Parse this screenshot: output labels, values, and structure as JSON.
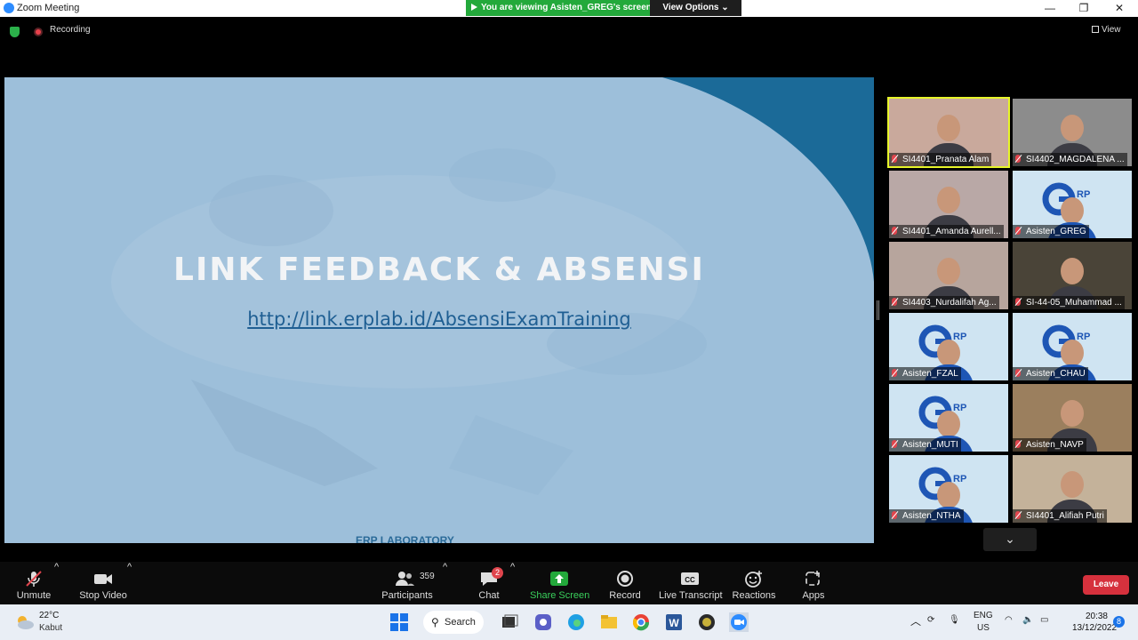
{
  "window": {
    "title": "Zoom Meeting",
    "minimize": "—",
    "maximize": "❐",
    "close": "✕"
  },
  "banner": {
    "viewing_text": "You are viewing Asisten_GREG's screen",
    "view_options": "View Options ⌄"
  },
  "status": {
    "recording": "Recording",
    "view": "View"
  },
  "slide": {
    "title": "LINK FEEDBACK & ABSENSI",
    "link": "http://link.erplab.id/AbsensiExamTraining",
    "footer": "ERP LABORATORY"
  },
  "participants_tiles": [
    {
      "name": "SI4401_Pranata Alam",
      "active": true,
      "bg": "#c9a99c"
    },
    {
      "name": "SI4402_MAGDALENA ...",
      "bg": "#8c8c8c"
    },
    {
      "name": "SI4401_Amanda Aurell...",
      "bg": "#b9a8a6"
    },
    {
      "name": "Asisten_GREG",
      "bg": "#cfe4f2"
    },
    {
      "name": "SI4403_Nurdalifah Ag...",
      "bg": "#b7a59d"
    },
    {
      "name": "SI-44-05_Muhammad ...",
      "bg": "#4a4438"
    },
    {
      "name": "Asisten_FZAL",
      "bg": "#cfe4f2"
    },
    {
      "name": "Asisten_CHAU",
      "bg": "#cfe4f2"
    },
    {
      "name": "Asisten_MUTI",
      "bg": "#cfe4f2"
    },
    {
      "name": "Asisten_NAVP",
      "bg": "#9b7f5e"
    },
    {
      "name": "Asisten_NTHA",
      "bg": "#cfe4f2"
    },
    {
      "name": "SI4401_Alifiah Putri",
      "bg": "#c4b29a"
    }
  ],
  "toolbar": {
    "unmute": "Unmute",
    "stop_video": "Stop Video",
    "participants": "Participants",
    "participants_count": "359",
    "chat": "Chat",
    "chat_badge": "2",
    "share_screen": "Share Screen",
    "record": "Record",
    "live_transcript": "Live Transcript",
    "reactions": "Reactions",
    "apps": "Apps",
    "leave": "Leave"
  },
  "taskbar": {
    "temperature": "22°C",
    "weather": "Kabut",
    "search": "Search",
    "lang": "ENG",
    "region": "US",
    "time": "20:38",
    "date": "13/12/2022",
    "notif_count": "8"
  },
  "colors": {
    "accent": "#2d8cff",
    "share_green": "#23a93b",
    "leave_red": "#d6313d",
    "active_speaker": "#e7f52a"
  }
}
